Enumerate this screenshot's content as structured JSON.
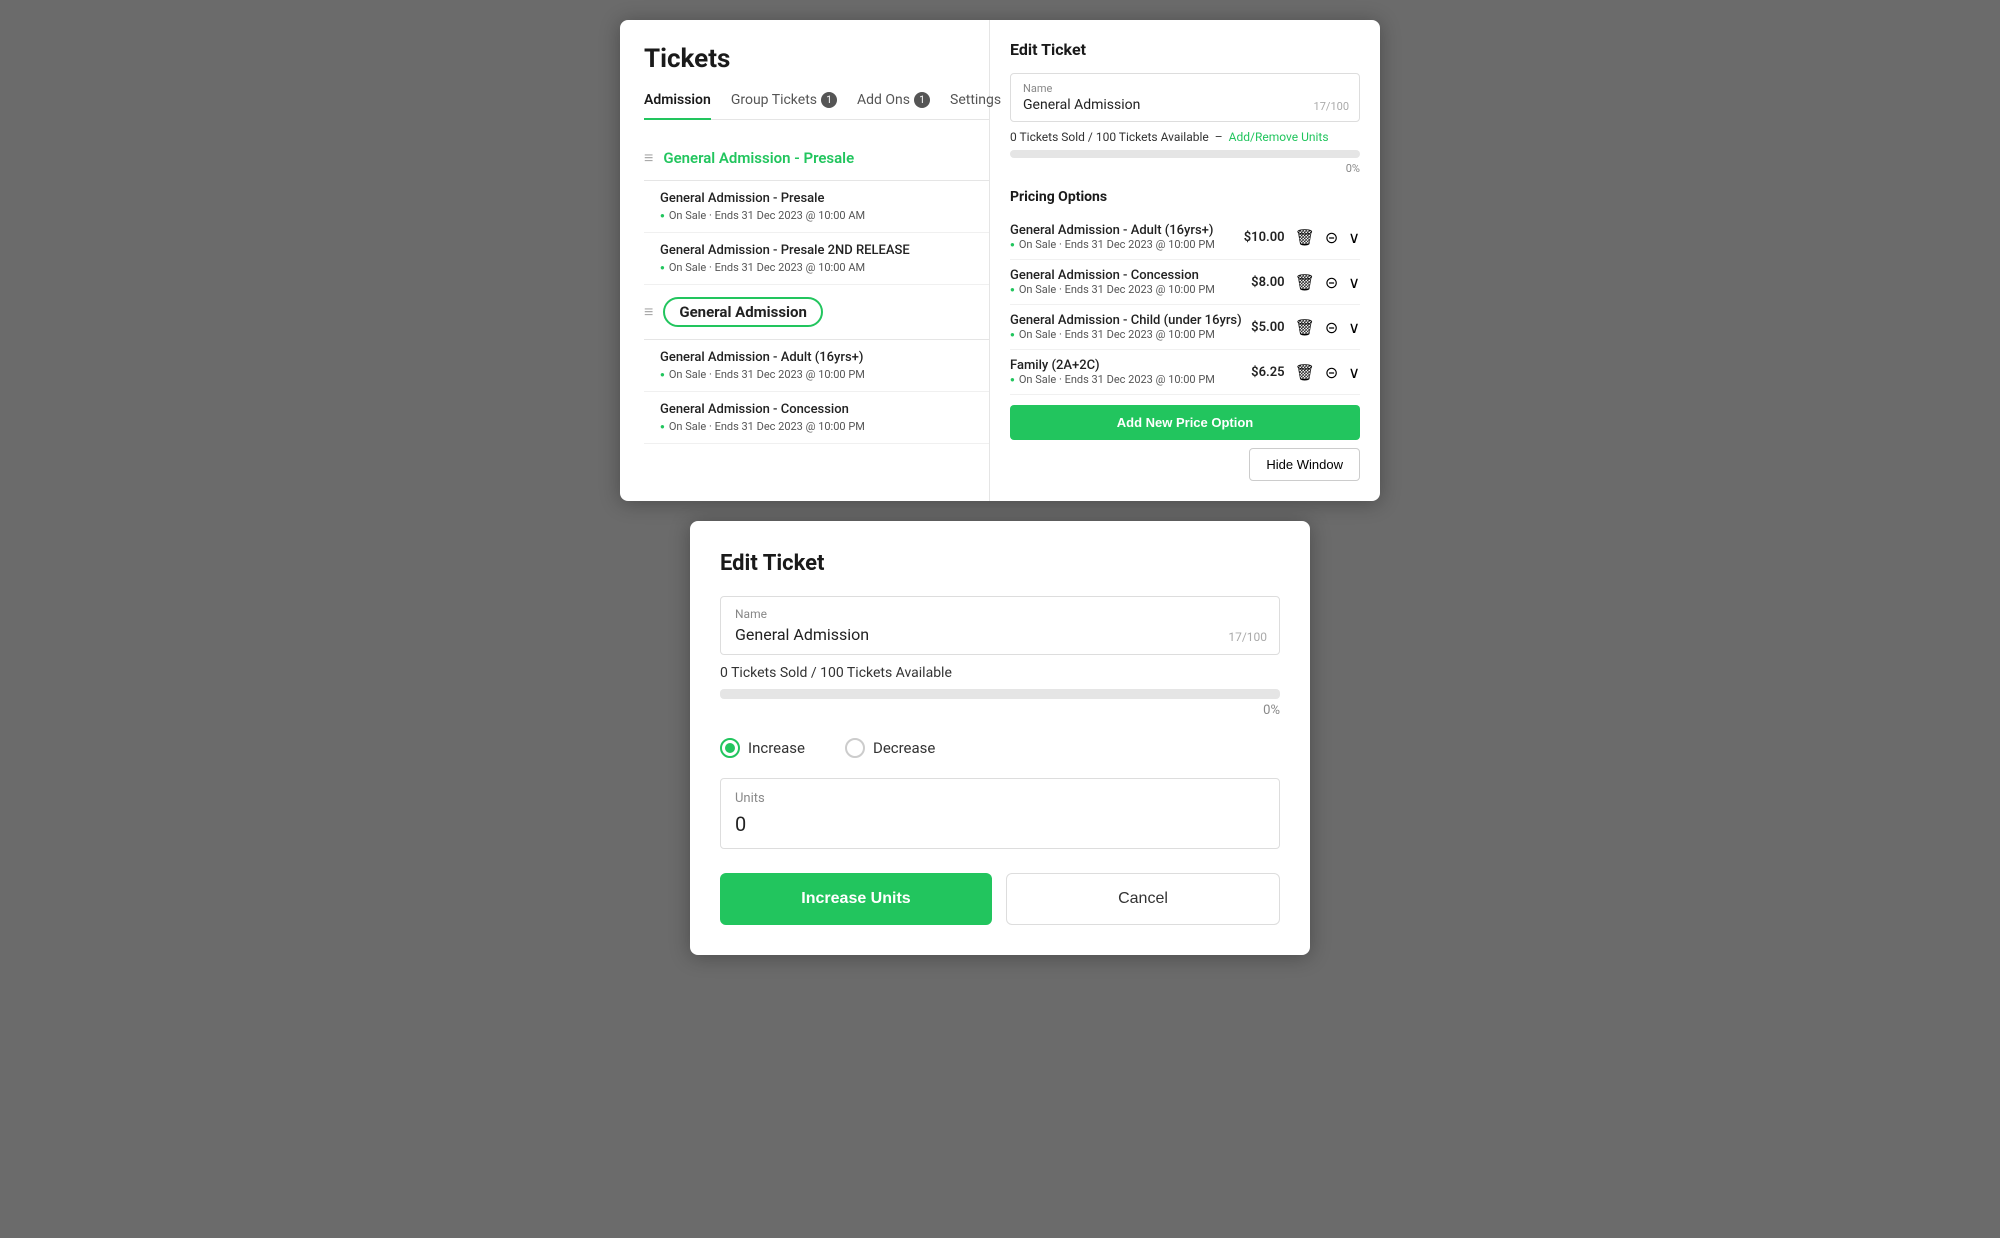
{
  "topPanel": {
    "leftSide": {
      "pageTitle": "Tickets",
      "tabs": [
        {
          "label": "Admission",
          "active": true,
          "badge": null
        },
        {
          "label": "Group Tickets",
          "active": false,
          "badge": "1"
        },
        {
          "label": "Add Ons",
          "active": false,
          "badge": "1"
        },
        {
          "label": "Settings",
          "active": false,
          "badge": null
        }
      ],
      "groups": [
        {
          "name": "General Admission - Presale",
          "items": [
            {
              "name": "General Admission - Presale",
              "meta": "On Sale · Ends 31 Dec 2023 @ 10:00 AM"
            },
            {
              "name": "General Admission - Presale 2ND RELEASE",
              "meta": "On Sale · Ends 31 Dec 2023 @ 10:00 AM"
            }
          ]
        },
        {
          "name": "General Admission",
          "highlighted": true,
          "items": [
            {
              "name": "General Admission - Adult (16yrs+)",
              "meta": "On Sale · Ends 31 Dec 2023 @ 10:00 PM"
            },
            {
              "name": "General Admission - Concession",
              "meta": "On Sale · Ends 31 Dec 2023 @ 10:00 PM"
            }
          ]
        }
      ]
    },
    "rightSide": {
      "title": "Edit Ticket",
      "nameLabel": "Name",
      "nameValue": "General Admission",
      "charCount": "17/100",
      "ticketsSold": "0 Tickets Sold / 100 Tickets Available",
      "addRemoveLink": "Add/Remove Units",
      "progressPercent": "0%",
      "pricingOptionsTitle": "Pricing Options",
      "priceOptions": [
        {
          "name": "General Admission - Adult (16yrs+)",
          "meta": "On Sale · Ends 31 Dec 2023 @ 10:00 PM",
          "price": "$10.00"
        },
        {
          "name": "General Admission - Concession",
          "meta": "On Sale · Ends 31 Dec 2023 @ 10:00 PM",
          "price": "$8.00"
        },
        {
          "name": "General Admission - Child (under 16yrs)",
          "meta": "On Sale · Ends 31 Dec 2023 @ 10:00 PM",
          "price": "$5.00"
        },
        {
          "name": "Family (2A+2C)",
          "meta": "On Sale · Ends 31 Dec 2023 @ 10:00 PM",
          "price": "$6.25"
        }
      ],
      "addPriceBtn": "Add New Price Option",
      "hideWindowBtn": "Hide Window"
    }
  },
  "bottomPanel": {
    "title": "Edit Ticket",
    "nameLabel": "Name",
    "nameValue": "General Admission",
    "charCount": "17/100",
    "ticketsSold": "0 Tickets Sold / 100 Tickets Available",
    "progressPercent": "0%",
    "radioOptions": [
      {
        "label": "Increase",
        "selected": true
      },
      {
        "label": "Decrease",
        "selected": false
      }
    ],
    "unitsLabel": "Units",
    "unitsValue": "0",
    "increaseUnitsBtn": "Increase Units",
    "cancelBtn": "Cancel"
  }
}
